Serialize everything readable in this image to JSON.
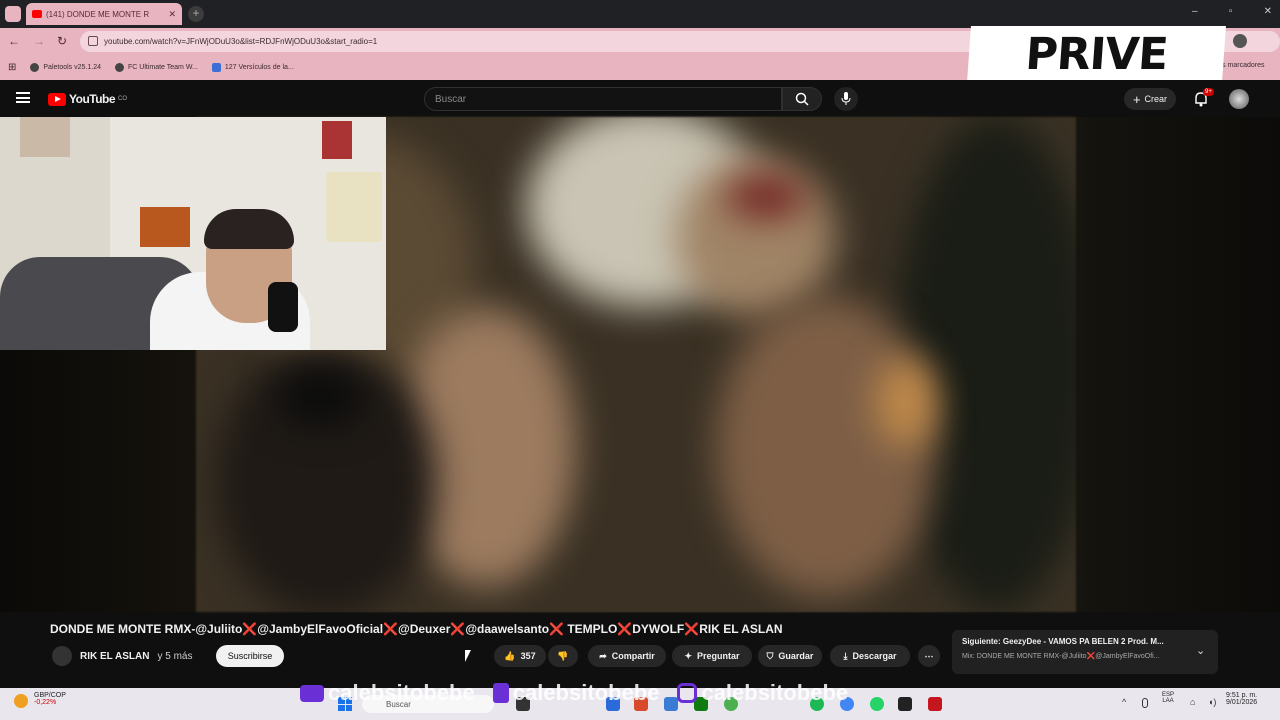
{
  "browser": {
    "tab_title": "(141) DONDE ME MONTE R",
    "url": "youtube.com/watch?v=JFnWjODuU3o&list=RDJFnWjODuU3o&start_radio=1",
    "bookmarks": [
      "Paletools v25.1.24",
      "FC Ultimate Team W...",
      "127 Versículos de la..."
    ],
    "bookmarks_right": "Todos los marcadores"
  },
  "overlay_logo": "PRIVE",
  "youtube": {
    "brand": "YouTube",
    "brand_sup": "CO",
    "search_placeholder": "Buscar",
    "create_label": "Crear",
    "notif_badge": "9+"
  },
  "video": {
    "title": "DONDE ME MONTE RMX-@Juliito❌@JambyElFavoOficial❌@Deuxer❌@daawelsanto❌ TEMPLO❌DYWOLF❌RIK EL ASLAN",
    "channel": "RIK EL ASLAN",
    "channel_more": "y 5 más",
    "subscribe_label": "Suscribirse",
    "likes": "357",
    "share_label": "Compartir",
    "ask_label": "Preguntar",
    "save_label": "Guardar",
    "download_label": "Descargar"
  },
  "up_next": {
    "line1": "Siguiente: GeezyDee - VAMOS PA BELEN 2 Prod. M...",
    "line2": "Mix: DONDE ME MONTE RMX-@Juliito❌@JambyElFavoOfi..."
  },
  "stream_overlay": [
    "calebsitobebe",
    "calebsitobebe",
    "calebsitobebe"
  ],
  "taskbar": {
    "ticker_label": "GBP/COP",
    "ticker_value": "-0,22%",
    "search_placeholder": "Buscar",
    "lang_line1": "ESP",
    "lang_line2": "LAA",
    "time": "9:51 p. m.",
    "date": "9/01/2026"
  }
}
